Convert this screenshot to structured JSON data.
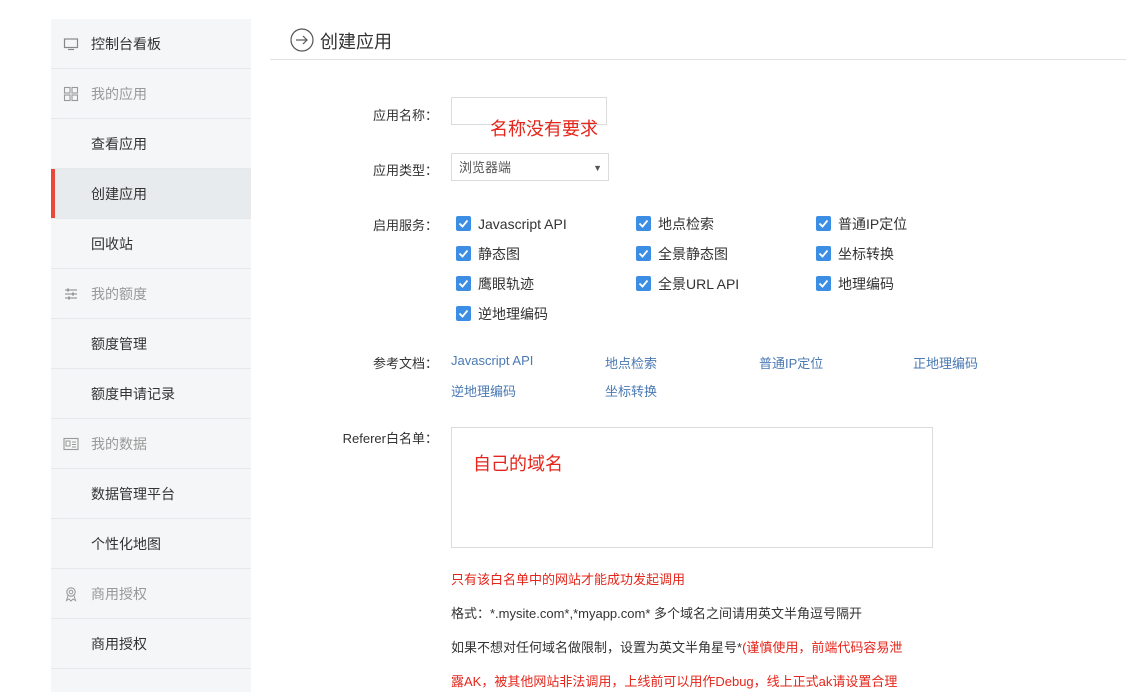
{
  "sidebar": {
    "items": [
      {
        "label": "控制台看板",
        "icon": "monitor-icon"
      },
      {
        "label": "我的应用",
        "icon": "grid-icon"
      },
      {
        "label": "查看应用"
      },
      {
        "label": "创建应用"
      },
      {
        "label": "回收站"
      },
      {
        "label": "我的额度",
        "icon": "sliders-icon"
      },
      {
        "label": "额度管理"
      },
      {
        "label": "额度申请记录"
      },
      {
        "label": "我的数据",
        "icon": "id-card-icon"
      },
      {
        "label": "数据管理平台"
      },
      {
        "label": "个性化地图"
      },
      {
        "label": "商用授权",
        "icon": "award-icon"
      },
      {
        "label": "商用授权"
      }
    ]
  },
  "header": {
    "title": "创建应用",
    "icon": "arrow-circle-right-icon"
  },
  "form": {
    "app_name_label": "应用名称：",
    "app_name_value": "",
    "app_name_annotation": "名称没有要求",
    "app_type_label": "应用类型：",
    "app_type_value": "浏览器端",
    "services_label": "启用服务：",
    "services": [
      {
        "label": "Javascript API",
        "checked": true
      },
      {
        "label": "地点检索",
        "checked": true
      },
      {
        "label": "普通IP定位",
        "checked": true
      },
      {
        "label": "静态图",
        "checked": true
      },
      {
        "label": "全景静态图",
        "checked": true
      },
      {
        "label": "坐标转换",
        "checked": true
      },
      {
        "label": "鹰眼轨迹",
        "checked": true
      },
      {
        "label": "全景URL API",
        "checked": true
      },
      {
        "label": "地理编码",
        "checked": true
      },
      {
        "label": "逆地理编码",
        "checked": true
      }
    ],
    "docs_label": "参考文档：",
    "docs": [
      "Javascript API",
      "地点检索",
      "普通IP定位",
      "正地理编码",
      "逆地理编码",
      "坐标转换"
    ],
    "referer_label": "Referer白名单：",
    "referer_annotation": "自己的域名",
    "notes": [
      "只有该白名单中的网站才能成功发起调用",
      "格式：*.mysite.com*,*myapp.com* 多个域名之间请用英文半角逗号隔开",
      "如果不想对任何域名做限制，设置为英文半角星号*",
      "(谨慎使用，前端代码容易泄",
      "露AK，被其他网站非法调用，上线前可以用作Debug，线上正式ak请设置合理"
    ]
  },
  "colors": {
    "accent": "#e8493a",
    "checkbox": "#3c8ee5",
    "link": "#4a79b3",
    "warning": "#e5251b"
  }
}
